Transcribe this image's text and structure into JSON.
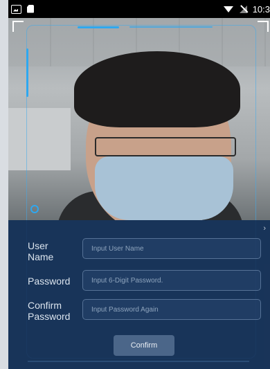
{
  "status_bar": {
    "time": "10:3",
    "left_icons": [
      "image-icon",
      "sd-card-icon"
    ],
    "right_icons": [
      "wifi-icon",
      "no-signal-icon"
    ]
  },
  "camera": {
    "description_icon": "face-preview"
  },
  "form": {
    "fields": [
      {
        "label": "User\nName",
        "placeholder": "Input User Name",
        "value": ""
      },
      {
        "label": "Password",
        "placeholder": "Input 6-Digit Password.",
        "value": ""
      },
      {
        "label": "Confirm\nPassword",
        "placeholder": "Input Password Again",
        "value": ""
      }
    ],
    "confirm_label": "Confirm"
  },
  "colors": {
    "hud_accent": "#2ea8f0",
    "panel_bg": "#1a365c",
    "button_bg": "#4b6689"
  }
}
